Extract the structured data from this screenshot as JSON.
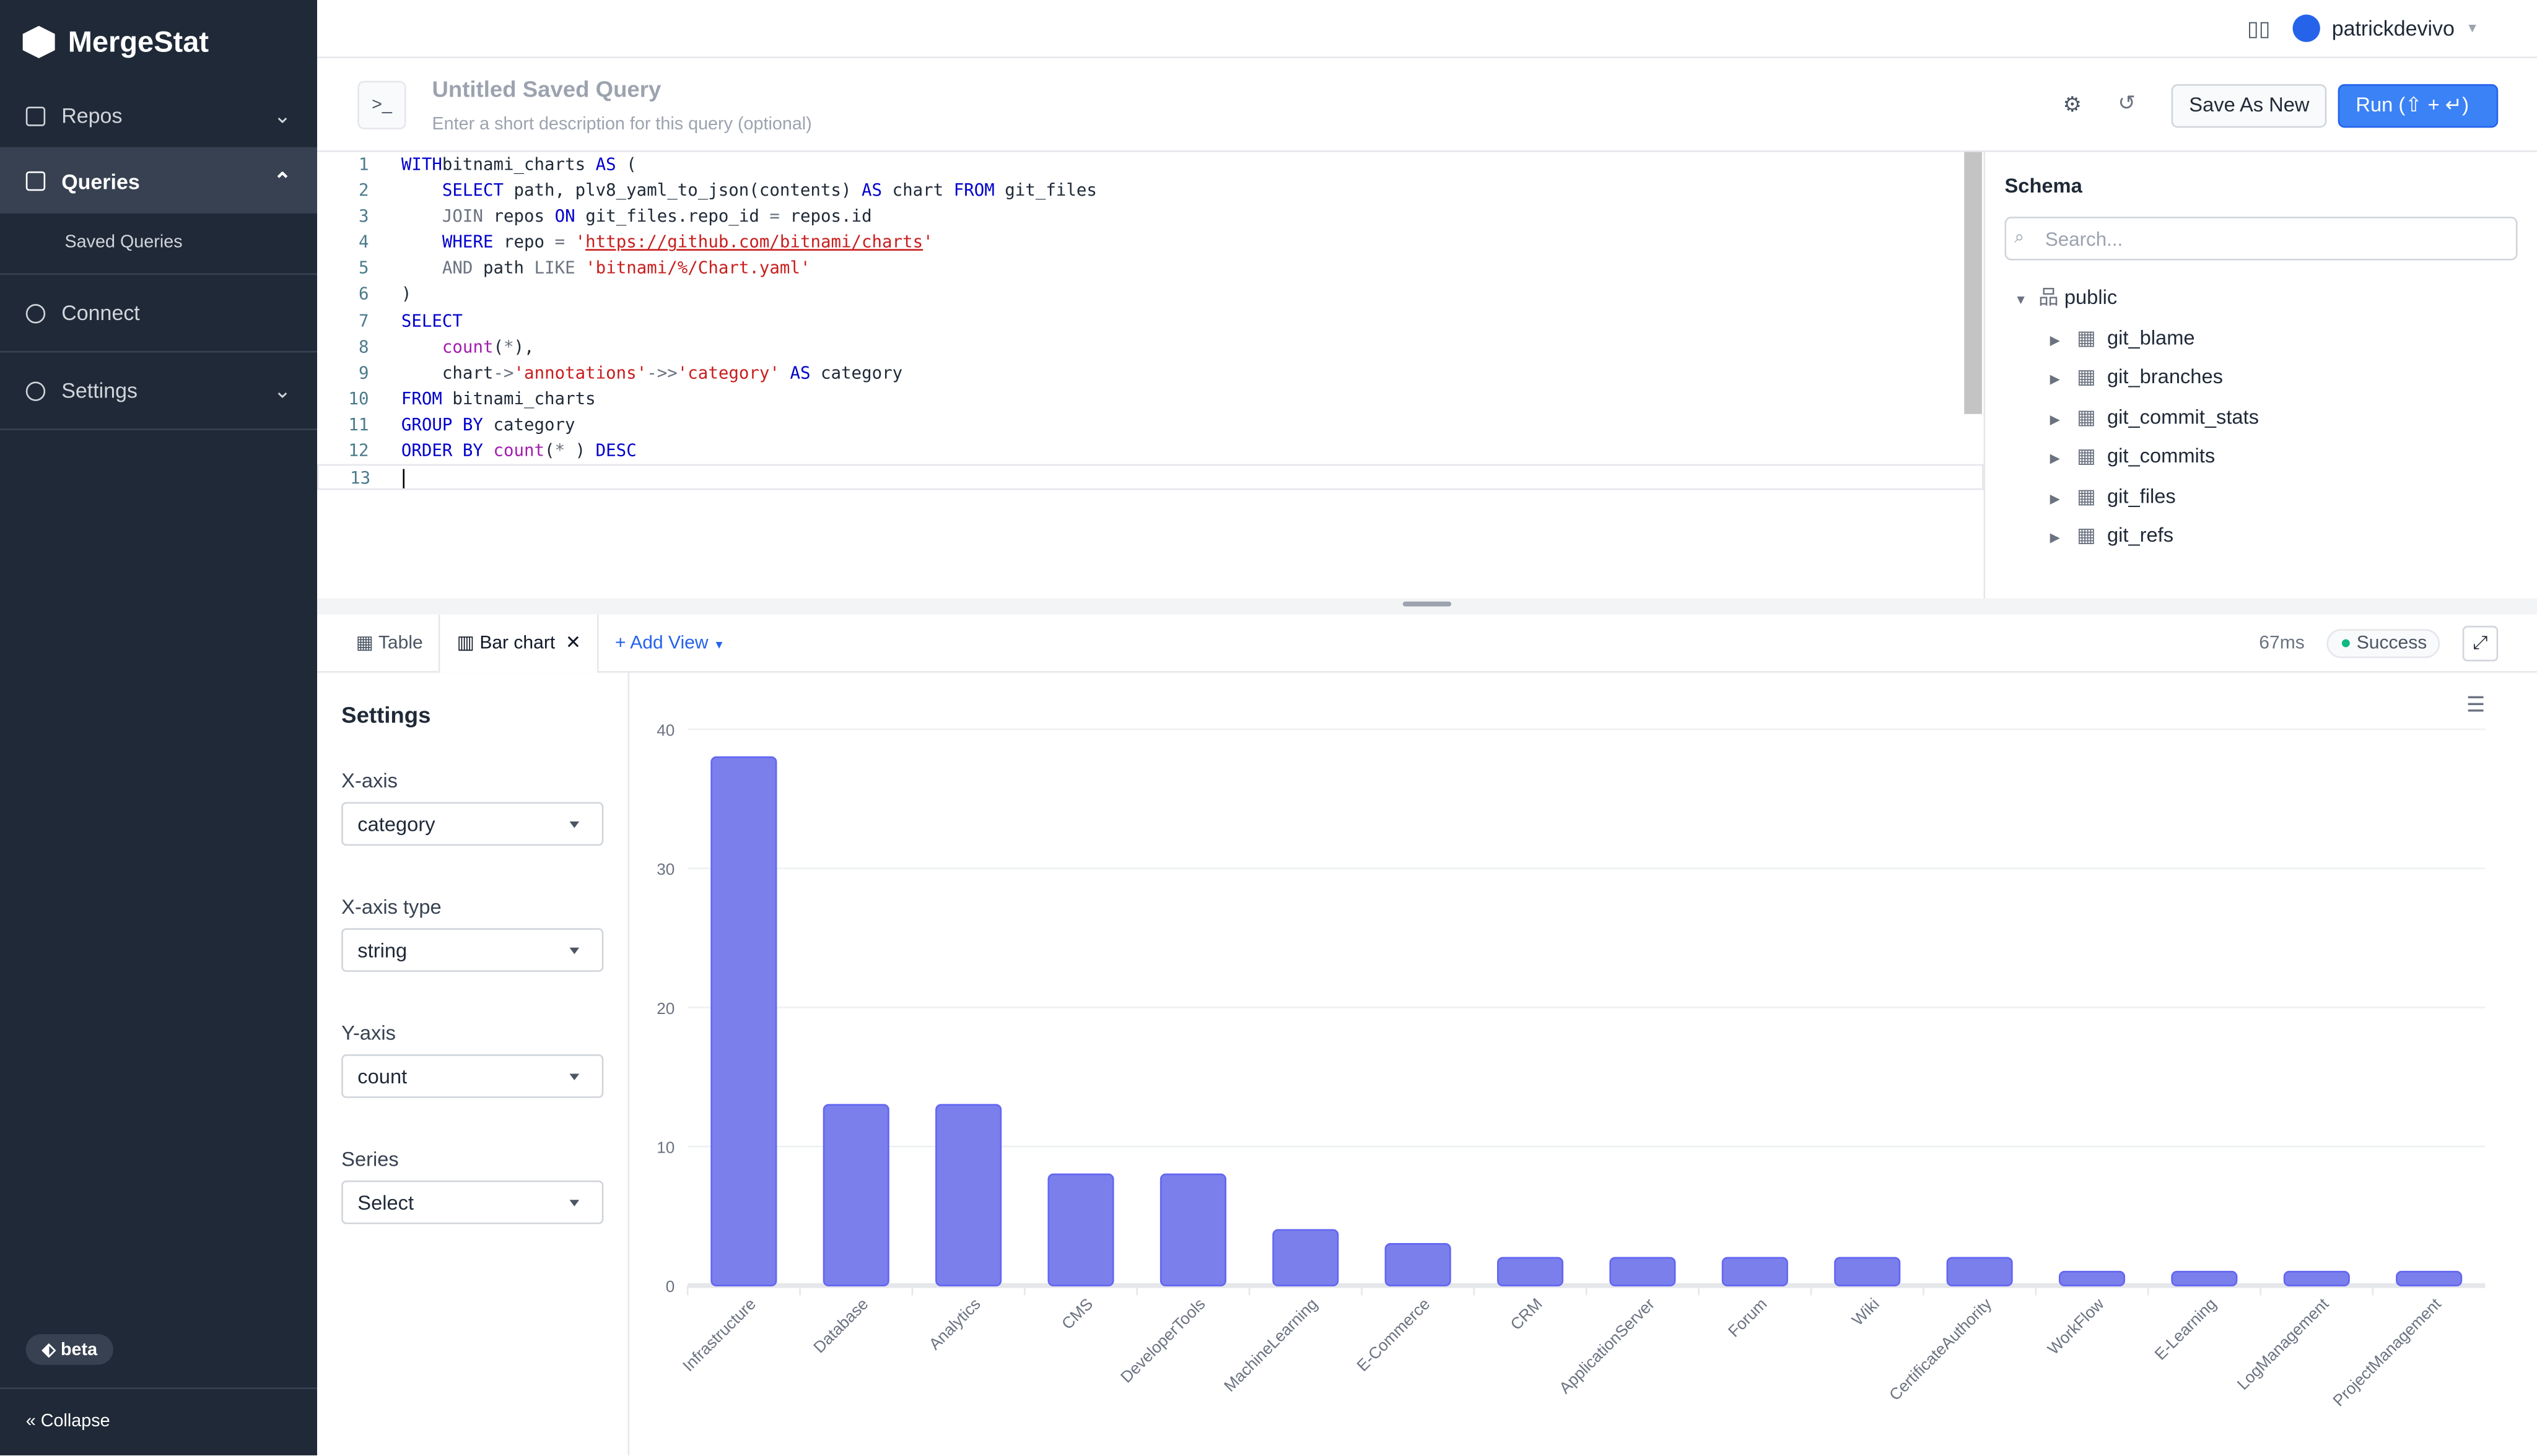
{
  "app": {
    "name": "MergeStat"
  },
  "sidebar": {
    "items": [
      {
        "label": "Repos",
        "icon": "repo-icon"
      },
      {
        "label": "Queries",
        "icon": "terminal-icon"
      },
      {
        "label": "Saved Queries"
      },
      {
        "label": "Connect",
        "icon": "database-icon"
      },
      {
        "label": "Settings",
        "icon": "gear-icon"
      }
    ],
    "beta": "beta",
    "collapse": "Collapse"
  },
  "topbar": {
    "user": "patrickdevivo"
  },
  "query": {
    "title": "Untitled Saved Query",
    "description_placeholder": "Enter a short description for this query (optional)",
    "save_as_new": "Save As New",
    "run": "Run (⇧ + ↵)"
  },
  "editor": {
    "lines": [
      [
        [
          "kw",
          "WITH"
        ],
        [
          "",
          "bitnami_charts "
        ],
        [
          "kw",
          "AS"
        ],
        [
          "",
          " ("
        ]
      ],
      [
        [
          "",
          "    "
        ],
        [
          "kw",
          "SELECT"
        ],
        [
          "",
          " path, plv8_yaml_to_json(contents) "
        ],
        [
          "kw",
          "AS"
        ],
        [
          "",
          " chart "
        ],
        [
          "kw",
          "FROM"
        ],
        [
          "",
          " git_files"
        ]
      ],
      [
        [
          "",
          "    "
        ],
        [
          "kw2",
          "JOIN"
        ],
        [
          "",
          " repos "
        ],
        [
          "kw",
          "ON"
        ],
        [
          "",
          " git_files.repo_id "
        ],
        [
          "op",
          "="
        ],
        [
          "",
          " repos.id"
        ]
      ],
      [
        [
          "",
          "    "
        ],
        [
          "kw",
          "WHERE"
        ],
        [
          "",
          " repo "
        ],
        [
          "op",
          "="
        ],
        [
          "",
          " "
        ],
        [
          "str",
          "'"
        ],
        [
          "url",
          "https://github.com/bitnami/charts"
        ],
        [
          "str",
          "'"
        ]
      ],
      [
        [
          "",
          "    "
        ],
        [
          "kw2",
          "AND"
        ],
        [
          "",
          " path "
        ],
        [
          "kw2",
          "LIKE"
        ],
        [
          "",
          " "
        ],
        [
          "str",
          "'bitnami/%/Chart.yaml'"
        ]
      ],
      [
        [
          "",
          ")"
        ]
      ],
      [
        [
          "kw",
          "SELECT"
        ]
      ],
      [
        [
          "",
          "    "
        ],
        [
          "fn",
          "count"
        ],
        [
          "",
          "("
        ],
        [
          "op",
          "*"
        ],
        [
          "",
          "),"
        ]
      ],
      [
        [
          "",
          "    chart"
        ],
        [
          "op",
          "->"
        ],
        [
          "str",
          "'annotations'"
        ],
        [
          "op",
          "->>"
        ],
        [
          "str",
          "'category'"
        ],
        [
          "",
          " "
        ],
        [
          "kw",
          "AS"
        ],
        [
          "",
          " category"
        ]
      ],
      [
        [
          "kw",
          "FROM"
        ],
        [
          "",
          " bitnami_charts"
        ]
      ],
      [
        [
          "kw",
          "GROUP BY"
        ],
        [
          "",
          " category"
        ]
      ],
      [
        [
          "kw",
          "ORDER BY"
        ],
        [
          "",
          " "
        ],
        [
          "fn",
          "count"
        ],
        [
          "",
          "("
        ],
        [
          "op",
          "*"
        ],
        [
          "",
          " ) "
        ],
        [
          "kw",
          "DESC"
        ]
      ],
      [
        [
          "",
          ""
        ]
      ]
    ]
  },
  "schema": {
    "title": "Schema",
    "search_placeholder": "Search...",
    "root": "public",
    "tables": [
      "git_blame",
      "git_branches",
      "git_commit_stats",
      "git_commits",
      "git_files",
      "git_refs"
    ]
  },
  "results": {
    "tabs": [
      "Table",
      "Bar chart"
    ],
    "add_view": "Add View",
    "duration": "67ms",
    "status": "Success",
    "status_color": "#10b981"
  },
  "settings": {
    "title": "Settings",
    "fields": [
      {
        "label": "X-axis",
        "value": "category"
      },
      {
        "label": "X-axis type",
        "value": "string"
      },
      {
        "label": "Y-axis",
        "value": "count"
      },
      {
        "label": "Series",
        "value": "Select"
      }
    ]
  },
  "chart_data": {
    "type": "bar",
    "categories": [
      "Infrastructure",
      "Database",
      "Analytics",
      "CMS",
      "DeveloperTools",
      "MachineLearning",
      "E-Commerce",
      "CRM",
      "ApplicationServer",
      "Forum",
      "Wiki",
      "CertificateAuthority",
      "WorkFlow",
      "E-Learning",
      "LogManagement",
      "ProjectManagement"
    ],
    "values": [
      38,
      13,
      13,
      8,
      8,
      4,
      3,
      2,
      2,
      2,
      2,
      2,
      1,
      1,
      1,
      1
    ],
    "yticks": [
      "0",
      "10",
      "20",
      "30",
      "40"
    ],
    "ylim": [
      0,
      40
    ],
    "grid": true,
    "color": "#7b7fec"
  }
}
